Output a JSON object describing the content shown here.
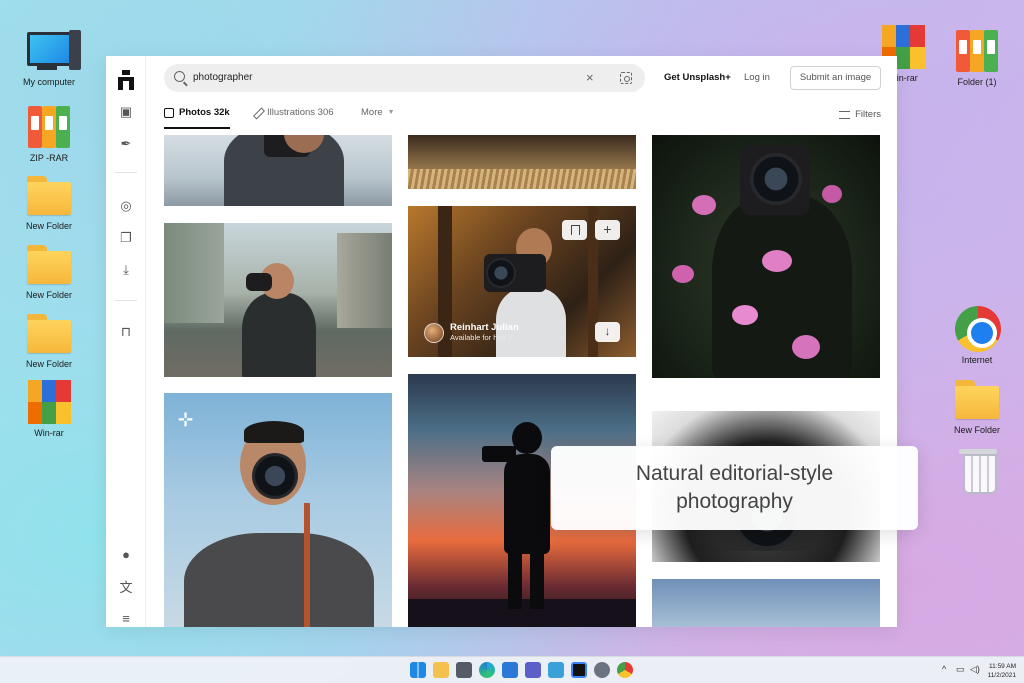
{
  "desktop": {
    "left_icons": [
      {
        "label": "My computer"
      },
      {
        "label": "ZIP -RAR"
      },
      {
        "label": "New Folder"
      },
      {
        "label": "New Folder"
      },
      {
        "label": "New Folder"
      },
      {
        "label": "Win-rar"
      }
    ],
    "right_icons": [
      {
        "label": "Win-rar"
      },
      {
        "label": "Folder (1)"
      },
      {
        "label": "Internet"
      },
      {
        "label": "New Folder"
      },
      {
        "label": "Recycle Bin"
      }
    ]
  },
  "browser": {
    "search": {
      "value": "photographer"
    },
    "header_links": {
      "get_plus": "Get Unsplash+",
      "login": "Log in",
      "submit": "Submit an image"
    },
    "tabs": [
      {
        "label": "Photos 32k",
        "active": true
      },
      {
        "label": "Illustrations 306",
        "active": false
      },
      {
        "label": "More",
        "active": false
      }
    ],
    "filters_label": "Filters",
    "featured_card": {
      "author": "Reinhart Julian",
      "status": "Available for hire"
    }
  },
  "overlay_caption": "Natural editorial-style photography",
  "taskbar": {
    "time": "11:59 AM",
    "date": "11/2/2021",
    "icons": [
      "start-icon",
      "search-icon",
      "file-explorer-icon",
      "camera-icon",
      "edge-icon",
      "store-icon",
      "teams-icon",
      "photos-icon",
      "tablet-icon",
      "unsplash-icon",
      "settings-icon",
      "chrome-icon"
    ]
  },
  "colors": {
    "accent": "#111111",
    "caption_text": "#444444",
    "taskbar": "#ecf0f6"
  }
}
